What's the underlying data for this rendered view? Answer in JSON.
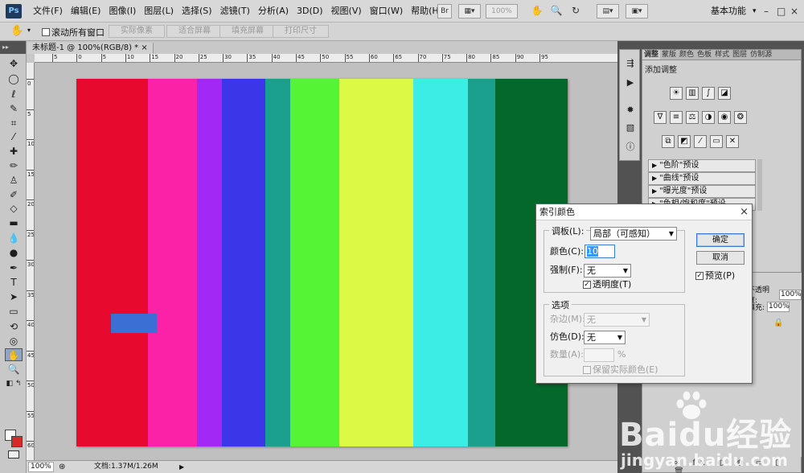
{
  "menubar": {
    "logo": "Ps",
    "items": [
      "文件(F)",
      "编辑(E)",
      "图像(I)",
      "图层(L)",
      "选择(S)",
      "滤镜(T)",
      "分析(A)",
      "3D(D)",
      "视图(V)",
      "窗口(W)",
      "帮助(H)"
    ],
    "tool_icons": [
      "bridge-icon",
      "view-extras-icon",
      "zoom-level-icon",
      "hand-icon",
      "zoom-icon",
      "rotate-icon",
      "arrange-documents-icon",
      "screen-mode-icon"
    ],
    "br_label": "Br",
    "zoom": "100%",
    "workspace": "基本功能",
    "workspace_arrow": "▾",
    "window_buttons": [
      "–",
      "□",
      "×"
    ]
  },
  "optionsbar": {
    "tool_icon": "hand-icon",
    "scroll_all_windows": "滚动所有窗口",
    "buttons": [
      "实际像素",
      "适合屏幕",
      "填充屏幕",
      "打印尺寸"
    ]
  },
  "document": {
    "tab_title": "未标题-1 @ 100%(RGB/8) *",
    "tab_close": "×",
    "ruler_h_labels": [
      "5",
      "0",
      "5",
      "10",
      "15",
      "20",
      "25",
      "30",
      "35",
      "40",
      "45",
      "50",
      "55",
      "60",
      "65",
      "70",
      "75",
      "80",
      "85",
      "90",
      "95"
    ],
    "ruler_v_labels": [
      "0",
      "5",
      "10",
      "15",
      "20",
      "25",
      "30",
      "35",
      "40",
      "45",
      "50",
      "55",
      "60"
    ],
    "stripes": [
      {
        "color": "#e8092e",
        "fraction": 0.145
      },
      {
        "color": "#fb22a7",
        "fraction": 0.1
      },
      {
        "color": "#a228f5",
        "fraction": 0.052
      },
      {
        "color": "#3b36e8",
        "fraction": 0.088
      },
      {
        "color": "#1aa08c",
        "fraction": 0.05
      },
      {
        "color": "#55f536",
        "fraction": 0.1
      },
      {
        "color": "#dcfa45",
        "fraction": 0.15
      },
      {
        "color": "#3bede5",
        "fraction": 0.112
      },
      {
        "color": "#1aa08c",
        "fraction": 0.055
      },
      {
        "color": "#05682b",
        "fraction": 0.148
      }
    ]
  },
  "statusbar": {
    "zoom": "100%",
    "doc_info": "文档:1.37M/1.26M",
    "arrow": "▶"
  },
  "tools": [
    "move-tool-icon",
    "marquee-tool-icon",
    "lasso-tool-icon",
    "quick-selection-tool-icon",
    "crop-tool-icon",
    "eyedropper-tool-icon",
    "healing-brush-tool-icon",
    "brush-tool-icon",
    "clone-stamp-tool-icon",
    "history-brush-tool-icon",
    "eraser-tool-icon",
    "gradient-tool-icon",
    "blur-tool-icon",
    "dodge-tool-icon",
    "pen-tool-icon",
    "type-tool-icon",
    "path-selection-tool-icon",
    "rectangle-tool-icon",
    "3d-rotate-tool-icon",
    "3d-orbit-tool-icon",
    "hand-tool-icon",
    "zoom-tool-icon"
  ],
  "right_panel": {
    "tabs": [
      "调整",
      "蒙版",
      "颜色",
      "色板",
      "样式",
      "图层",
      "仿制源"
    ],
    "add_adjustment": "添加调整",
    "presets": [
      "\"色阶\"预设",
      "\"曲线\"预设",
      "\"曝光度\"预设",
      "\"色相/饱和度\"预设"
    ],
    "preset_arrow": "▶",
    "opacity_label": "不透明度:",
    "opacity": "100%",
    "fill_label": "填充:",
    "fill": "100%"
  },
  "dialog": {
    "title": "索引颜色",
    "close": "×",
    "palette_label": "调板(L):",
    "palette_value": "局部（可感知）",
    "colors_label": "颜色(C):",
    "colors_value": "10",
    "forced_label": "强制(F):",
    "forced_value": "无",
    "transparency_label": "透明度(T)",
    "options_title": "选项",
    "matte_label": "杂边(M):",
    "matte_value": "无",
    "dither_label": "仿色(D):",
    "dither_value": "无",
    "amount_label": "数量(A):",
    "amount_unit": "%",
    "preserve_label": "保留实际颜色(E)",
    "ok": "确定",
    "cancel": "取消",
    "preview_label": "预览(P)"
  },
  "watermark": {
    "main": "Baidu经验",
    "url": "jingyan.baidu.com"
  }
}
